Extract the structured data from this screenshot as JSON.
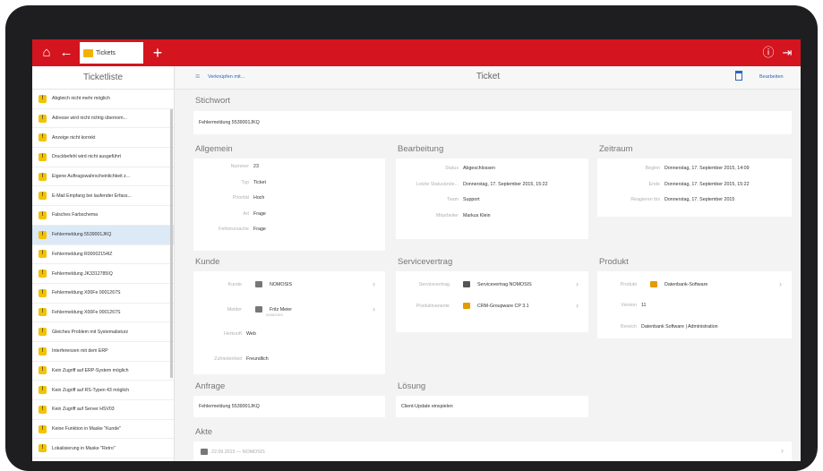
{
  "header": {
    "tab_label": "Tickets"
  },
  "sidebar": {
    "title": "Ticketliste",
    "items": [
      "Abgleich nicht mehr möglich",
      "Adresse wird nicht richtig übernom...",
      "Anzeige nicht korrekt",
      "Druckbefehl wird nicht ausgeführt",
      "Eigene Auftragswahrscheinlichkeit z...",
      "E-Mail Empfang bei laufender Erfass...",
      "Falsches Farbschema",
      "Fehlermeldung 5539001JKQ",
      "Fehlermeldung R00002154IZ",
      "Fehlermeldung JK3312785IQ",
      "Fehlermeldung X00Fe 0001267S",
      "Fehlermeldung X00Fe 0001267S",
      "Gleiches Problem mit Systemabsturz",
      "Interferenzen mit dem ERP",
      "Kein Zugriff auf ERP-System möglich",
      "Kein Zugriff auf RS-Typen 43 möglich",
      "Kein Zugriff auf Server HSV03",
      "Keine Funktion in Maske \"Kunde\"",
      "Lokalisierung in Maske \"Retro\""
    ],
    "selected_index": 7
  },
  "main": {
    "link": "Verknüpfen mit...",
    "title": "Ticket",
    "edit": "Bearbeiten",
    "stichwort": {
      "heading": "Stichwort",
      "value": "Fehlermeldung 5539001JKQ"
    },
    "allgemein": {
      "heading": "Allgemein",
      "rows": [
        {
          "label": "Nummer",
          "value": "23"
        },
        {
          "label": "Typ",
          "value": "Ticket"
        },
        {
          "label": "Priorität",
          "value": "Hoch"
        },
        {
          "label": "Art",
          "value": "Frage"
        },
        {
          "label": "Fehlerursache",
          "value": "Frage"
        }
      ]
    },
    "bearbeitung": {
      "heading": "Bearbeitung",
      "rows": [
        {
          "label": "Status",
          "value": "Abgeschlossen"
        },
        {
          "label": "Letzte Statusände...",
          "value": "Donnerstag, 17. September 2015, 15:22"
        },
        {
          "label": "Team",
          "value": "Support"
        },
        {
          "label": "Mitarbeiter",
          "value": "Markus Klein"
        }
      ]
    },
    "zeitraum": {
      "heading": "Zeitraum",
      "rows": [
        {
          "label": "Beginn",
          "value": "Donnerstag, 17. September 2015, 14:09"
        },
        {
          "label": "Ende",
          "value": "Donnerstag, 17. September 2015, 15:22"
        },
        {
          "label": "Reagieren bis",
          "value": "Donnerstag, 17. September 2015"
        }
      ]
    },
    "kunde": {
      "heading": "Kunde",
      "rows": [
        {
          "label": "Kunde",
          "value": "NOMOSIS"
        },
        {
          "label": "Melder",
          "value": "Fritz Meier",
          "sub": "NOMOSIS"
        },
        {
          "label": "Herkunft",
          "value": "Web"
        },
        {
          "label": "Zufriedenheit",
          "value": "Freundlich"
        }
      ]
    },
    "servicevertrag": {
      "heading": "Servicevertrag",
      "rows": [
        {
          "label": "Servicevertrag",
          "value": "Servicevertrag NOMOSIS"
        },
        {
          "label": "Produktvariante",
          "value": "CRM-Groupware CP 3.1"
        }
      ]
    },
    "produkt": {
      "heading": "Produkt",
      "rows": [
        {
          "label": "Produkt",
          "value": "Datenbank-Software"
        },
        {
          "label": "Version",
          "value": "11"
        },
        {
          "label": "Bereich",
          "value": "Datenbank Software | Administration"
        }
      ]
    },
    "anfrage": {
      "heading": "Anfrage",
      "value": "Fehlermeldung 5539001JKQ"
    },
    "loesung": {
      "heading": "Lösung",
      "value": "Client-Update einspielen"
    },
    "akte": {
      "heading": "Akte",
      "value": "22.09.2015 — NOMOSIS"
    }
  }
}
